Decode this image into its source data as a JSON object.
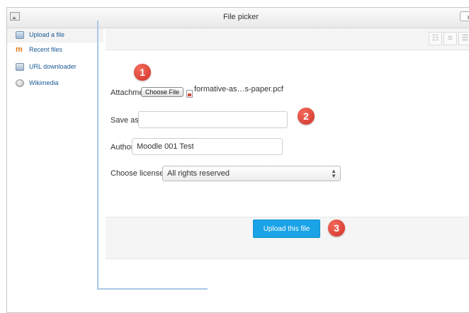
{
  "window": {
    "title": "File picker",
    "close_label": "x"
  },
  "sidebar": {
    "items": [
      {
        "label": "Upload a file",
        "icon": "upload-icon",
        "active": true
      },
      {
        "label": "Recent files",
        "icon": "recent-files-icon"
      },
      {
        "label": "URL downloader",
        "icon": "url-downloader-icon"
      },
      {
        "label": "Wikimedia",
        "icon": "wikimedia-icon"
      }
    ]
  },
  "toolbar": {
    "views": [
      "icons-view",
      "list-view",
      "tree-view"
    ]
  },
  "form": {
    "attachment_label": "Attachment",
    "choose_file_label": "Choose File",
    "filename": "formative-as…s-paper.pcf",
    "save_as_label": "Save as",
    "save_as_value": "",
    "author_label": "Author",
    "author_value": "Moodle 001 Test",
    "license_label": "Choose license",
    "license_value": "All rights reserved"
  },
  "actions": {
    "upload_label": "Upload this file"
  },
  "annotations": {
    "step1": "1",
    "step2": "2",
    "step3": "3"
  },
  "colors": {
    "primary_button": "#1aa3e6",
    "badge": "#d2312a",
    "divider": "#a9c9e6"
  }
}
